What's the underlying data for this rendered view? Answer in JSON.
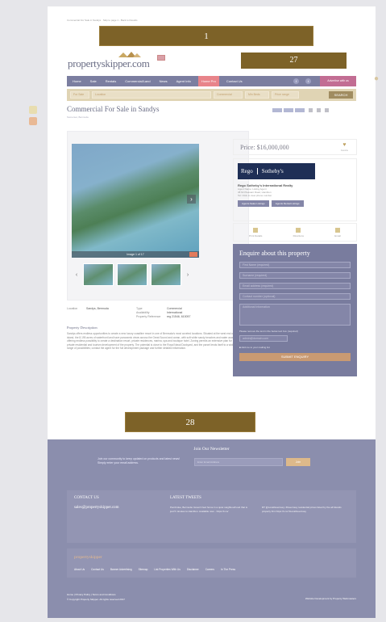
{
  "breadcrumb": "Commercial For Sale in Sandys · Skip to page 1 - Back to Results",
  "ads": {
    "top": "1",
    "right": "27",
    "bottom": "28"
  },
  "logo": "propertyskipper.com",
  "nav": {
    "items": [
      "Home",
      "Sale",
      "Rentals",
      "Commercial/Land",
      "News",
      "Agent Info",
      "Home Pro",
      "Contact Us"
    ],
    "advertise": "Advertise with us"
  },
  "search": {
    "type_placeholder": "For Sale",
    "location_placeholder": "Location",
    "f1": "Commercial",
    "f2": "Min Beds",
    "f3": "Price range",
    "button": "SEARCH"
  },
  "listing": {
    "title": "Commercial For Sale in Sandys",
    "subtitle": "Somerset, Bermuda",
    "photo_caption": "Image 1 of 17",
    "price": "Price: $16,000,000",
    "save_label": "Favorite",
    "details": {
      "location_label": "Location",
      "location": "Sandys, Bermuda",
      "type_label": "Type",
      "type": "Commercial",
      "availability_label": "Availability",
      "availability": "International",
      "ref_label": "Property Reference",
      "ref": "reg 21546, 610057"
    },
    "desc_title": "Property Description",
    "description": "Sandys offers endless opportunities to create a new luxury coastline resort in one of Bermuda's most coveted locations. Situated at the west end of the island, the 8.195 acres of waterfront land have panoramic views across the Great Sound and ocean, with soft white sandy beaches and water access, offering endless possibility to create a destination resort, private residences, marina, spa and boutique hotel. Zoning permits an extensive plan for private residential and tourism development of the property. The potential is close to the Royal Naval Dockyard, and the parcel lends itself to a wide range of possibilities; contact the agent for the full development package and further detailed information."
  },
  "agent": {
    "logo_left": "Rego",
    "logo_right": "Sotheby's",
    "name": "Rego Sotheby's International Realty",
    "lines": [
      "Agent Name: Listing Agent",
      "38 Mt Pleasant Road, Hamilton",
      "Tel: Click to view phone number"
    ],
    "btn1": "Agents Sales Listings",
    "btn2": "Agents Rental Listings"
  },
  "actions": [
    "Print Details",
    "Directions",
    "Email"
  ],
  "enquiry": {
    "title": "Enquire about this property",
    "fields": [
      "First Name (required)",
      "Surname (required)",
      "Email address (required)",
      "Contact number (optional)"
    ],
    "message": "Additional Information",
    "note": "Please remove the text in the below text box (required)",
    "captcha": "admin@domain.com",
    "checkbox": "Add me to your mailing list",
    "submit": "SUBMIT ENQUIRY"
  },
  "footer": {
    "newsletter_title": "Join Our Newsletter",
    "newsletter_text": "Join our community to keep updated on products and latest news! Simply enter your email address.",
    "email_placeholder": "Enter Email Address",
    "join": "Join",
    "contact_head": "CONTACT US",
    "contact_email": "sales@propertyskipper.com",
    "tweets_head": "LATEST TWEETS",
    "tweet1": "Pembroke, Bermuda: Great 3 bed home in a quiet neighbourhood that is just 5 minutes to Hamilton. Available now... https://t.co/",
    "tweet2": "RT @LocalGuernsey: #Guernsey residential prices listed by the all Islands property firm https://t.co/ #LocalGuernsey",
    "brand": "propertyskipper",
    "links": [
      "About Us",
      "Contact Us",
      "Banner Advertising",
      "Sitemap",
      "List Properties With Us",
      "Disclaimer",
      "Careers",
      "In The Press"
    ],
    "bottom_links": "Home  |  Privacy Policy  |  Terms and Conditions",
    "copyright": "© Copyright Property Skipper. All rights reserved 2017",
    "credit": "Website Development by Property Webmasters"
  },
  "colors": {
    "nav": "#7b7ea0",
    "accent": "#c99a72",
    "ad": "#7d6228",
    "footer": "#8b8ead"
  }
}
